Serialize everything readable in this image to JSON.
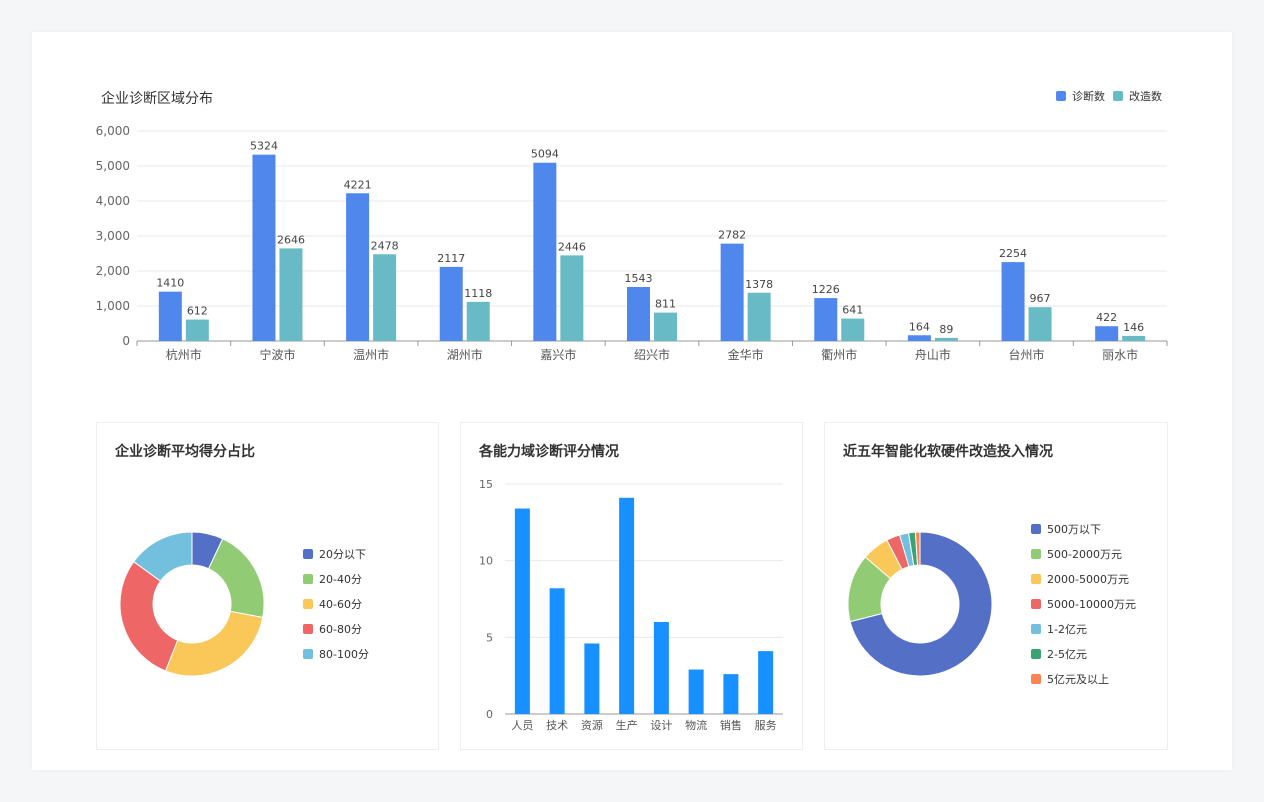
{
  "chart_data": [
    {
      "type": "bar",
      "title": "企业诊断区域分布",
      "categories": [
        "杭州市",
        "宁波市",
        "温州市",
        "湖州市",
        "嘉兴市",
        "绍兴市",
        "金华市",
        "衢州市",
        "舟山市",
        "台州市",
        "丽水市"
      ],
      "series": [
        {
          "name": "诊断数",
          "color": "#5087ec",
          "values": [
            1410,
            5324,
            4221,
            2117,
            5094,
            1543,
            2782,
            1226,
            164,
            2254,
            422
          ]
        },
        {
          "name": "改造数",
          "color": "#68bbc4",
          "values": [
            612,
            2646,
            2478,
            1118,
            2446,
            811,
            1378,
            641,
            89,
            967,
            146
          ]
        }
      ],
      "ylim": [
        0,
        6000
      ],
      "yticks": [
        "0",
        "1,000",
        "2,000",
        "3,000",
        "4,000",
        "5,000",
        "6,000"
      ],
      "grid": true,
      "legend": "top-right",
      "data_labels": true
    },
    {
      "type": "pie",
      "donut": true,
      "title": "企业诊断平均得分占比",
      "labels": [
        "20分以下",
        "20-40分",
        "40-60分",
        "60-80分",
        "80-100分"
      ],
      "values": [
        7,
        21,
        28,
        29,
        15
      ],
      "colors": [
        "#5470c6",
        "#91cc75",
        "#fac858",
        "#ee6666",
        "#73c0de"
      ],
      "legend": "right"
    },
    {
      "type": "bar",
      "title": "各能力域诊断评分情况",
      "categories": [
        "人员",
        "技术",
        "资源",
        "生产",
        "设计",
        "物流",
        "销售",
        "服务"
      ],
      "values": [
        13.4,
        8.2,
        4.6,
        14.1,
        6.0,
        2.9,
        2.6,
        4.1
      ],
      "color": "#1890ff",
      "ylim": [
        0,
        15
      ],
      "yticks": [
        "0",
        "5",
        "10",
        "15"
      ],
      "grid": true
    },
    {
      "type": "pie",
      "donut": true,
      "title": "近五年智能化软硬件改造投入情况",
      "labels": [
        "500万以下",
        "500-2000万元",
        "2000-5000万元",
        "5000-10000万元",
        "1-2亿元",
        "2-5亿元",
        "5亿元及以上"
      ],
      "values": [
        70,
        15,
        6,
        3,
        2,
        1.5,
        1
      ],
      "colors": [
        "#5470c6",
        "#91cc75",
        "#fac858",
        "#ee6666",
        "#73c0de",
        "#3ba272",
        "#fc8452"
      ],
      "legend": "right"
    }
  ]
}
